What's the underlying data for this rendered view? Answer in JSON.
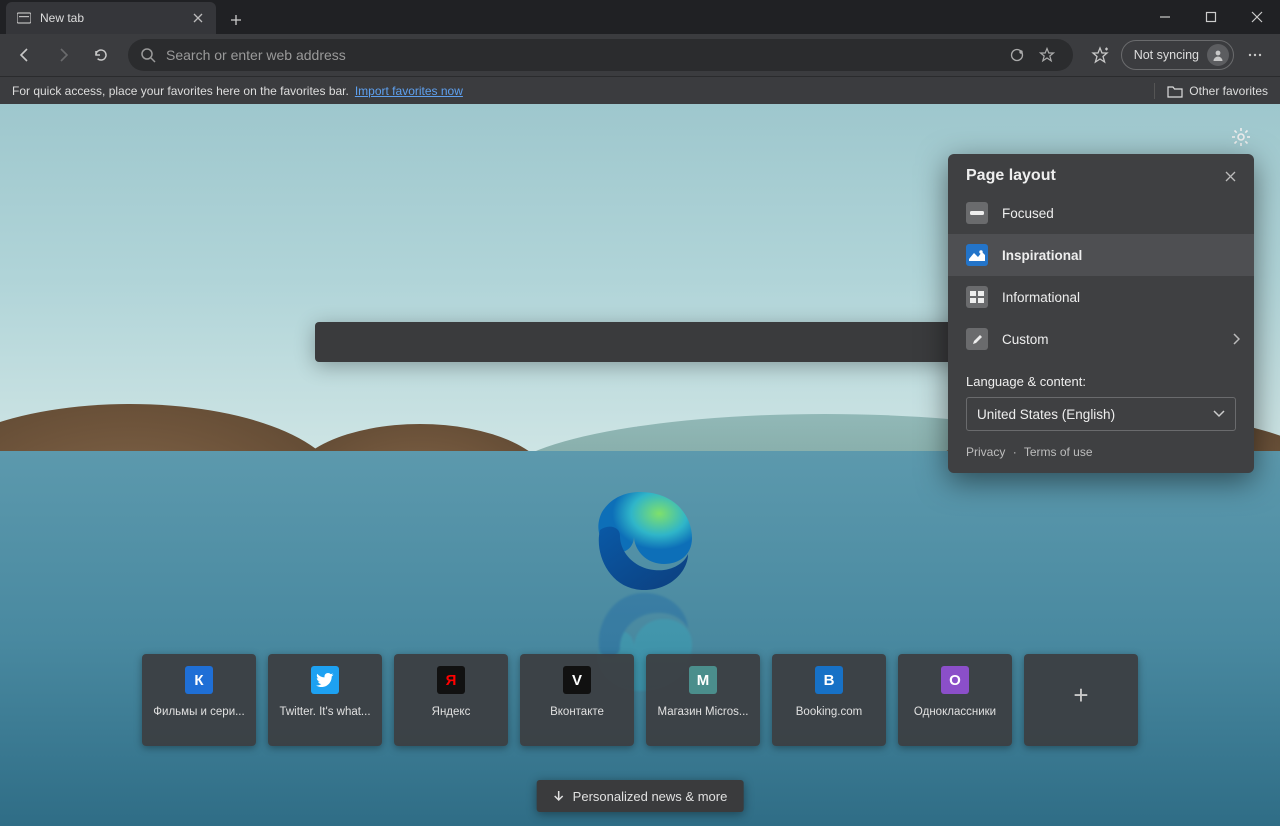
{
  "tab": {
    "title": "New tab"
  },
  "toolbar": {
    "address_placeholder": "Search or enter web address",
    "sync_label": "Not syncing"
  },
  "favbar": {
    "hint": "For quick access, place your favorites here on the favorites bar.",
    "import_link": "Import favorites now",
    "other": "Other favorites"
  },
  "ntp": {
    "search_placeholder": "",
    "news_label": "Personalized news & more"
  },
  "tiles": [
    {
      "label": "Фильмы и сери...",
      "letter": "К",
      "bg": "#1f6fd6"
    },
    {
      "label": "Twitter. It's what...",
      "letter": "",
      "bg": "#1da1f2",
      "icon": "twitter"
    },
    {
      "label": "Яндекс",
      "letter": "Я",
      "bg": "#111",
      "fg": "#ff0000"
    },
    {
      "label": "Вконтакте",
      "letter": "V",
      "bg": "#111"
    },
    {
      "label": "Магазин Micros...",
      "letter": "M",
      "bg": "#4b8e8c"
    },
    {
      "label": "Booking.com",
      "letter": "B",
      "bg": "#1771c6"
    },
    {
      "label": "Одноклассники",
      "letter": "O",
      "bg": "#8b4fc9"
    }
  ],
  "panel": {
    "title": "Page layout",
    "items": [
      {
        "label": "Focused",
        "icon": "focused"
      },
      {
        "label": "Inspirational",
        "icon": "inspirational",
        "selected": true
      },
      {
        "label": "Informational",
        "icon": "informational"
      },
      {
        "label": "Custom",
        "icon": "custom",
        "chevron": true
      }
    ],
    "lang_label": "Language & content:",
    "lang_value": "United States (English)",
    "footer_privacy": "Privacy",
    "footer_terms": "Terms of use"
  }
}
